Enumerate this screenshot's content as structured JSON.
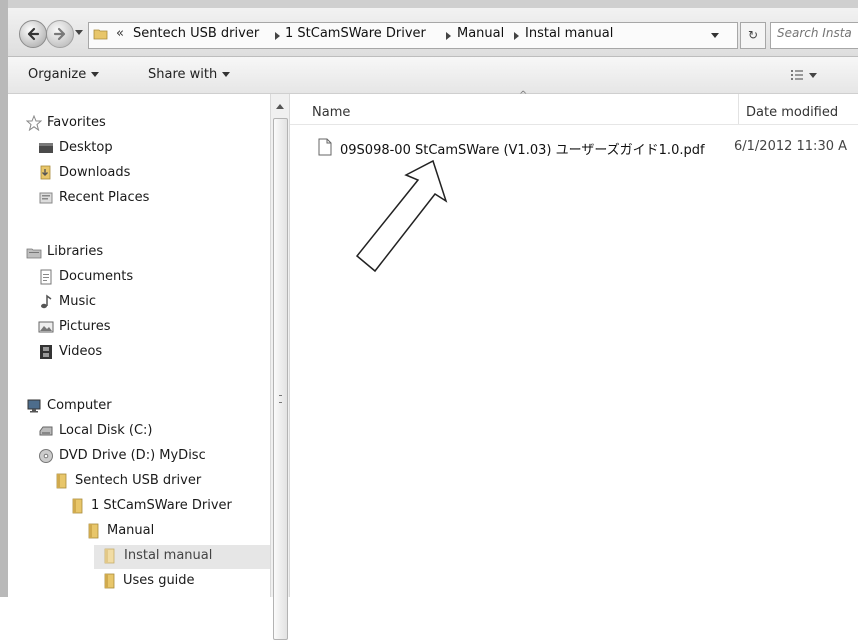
{
  "address_bar": {
    "overflow_chevron": "«",
    "crumbs": [
      "Sentech USB driver",
      "1 StCamSWare Driver",
      "Manual",
      "Instal manual"
    ],
    "refresh_symbol": "↻"
  },
  "search": {
    "placeholder": "Search Insta"
  },
  "toolbar": {
    "organize": "Organize",
    "share_with": "Share with"
  },
  "nav_pane": {
    "favorites": {
      "label": "Favorites",
      "items": [
        "Desktop",
        "Downloads",
        "Recent Places"
      ]
    },
    "libraries": {
      "label": "Libraries",
      "items": [
        "Documents",
        "Music",
        "Pictures",
        "Videos"
      ]
    },
    "computer": {
      "label": "Computer",
      "items": [
        "Local Disk (C:)",
        "DVD Drive (D:) MyDisc",
        "Sentech USB driver",
        "1 StCamSWare Driver",
        "Manual",
        "Instal manual",
        "Uses guide"
      ]
    },
    "selected": "Instal manual"
  },
  "columns": {
    "name": "Name",
    "date_modified": "Date modified"
  },
  "files": [
    {
      "name": "09S098-00 StCamSWare (V1.03) ユーザーズガイド1.0.pdf",
      "date_modified": "6/1/2012 11:30 A",
      "type": "pdf"
    }
  ],
  "colors": {
    "selected_background": "#e6e6e6",
    "folder_yellow": "#e8c66a"
  }
}
